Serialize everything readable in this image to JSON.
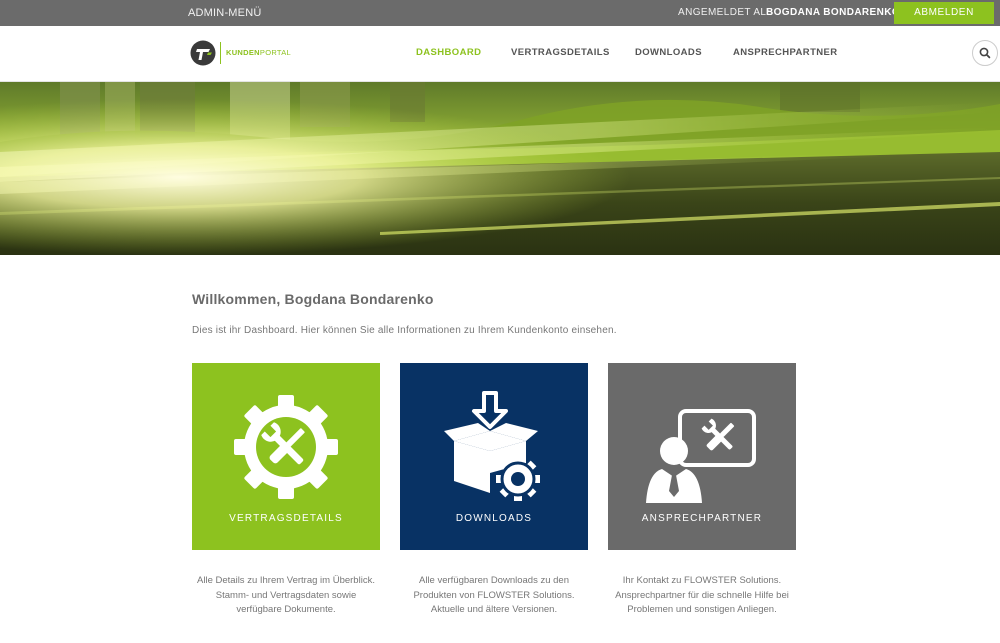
{
  "adminbar": {
    "menu_label": "ADMIN-MENÜ",
    "logged_in_label": "ANGEMELDET ALS",
    "user_name": "BOGDANA BONDARENKO",
    "logout_label": "ABMELDEN"
  },
  "header": {
    "logo_text_bold": "KUNDEN",
    "logo_text_light": "PORTAL",
    "nav": [
      {
        "label": "DASHBOARD",
        "active": true
      },
      {
        "label": "VERTRAGSDETAILS",
        "active": false
      },
      {
        "label": "DOWNLOADS",
        "active": false
      },
      {
        "label": "ANSPRECHPARTNER",
        "active": false
      }
    ],
    "search_icon": "search-icon"
  },
  "colors": {
    "accent": "#8dc21f",
    "navy": "#083264",
    "gray_tile": "#6a6a6a",
    "admin_bar": "#6b6b6b"
  },
  "main": {
    "title": "Willkommen, Bogdana Bondarenko",
    "intro": "Dies ist ihr Dashboard. Hier können Sie alle Informationen zu Ihrem Kundenkonto einsehen.",
    "tiles": [
      {
        "label": "VERTRAGSDETAILS",
        "icon": "gear-tools-icon",
        "desc": [
          "Alle Details zu Ihrem Vertrag im Überblick.",
          "Stamm- und Vertragsdaten sowie verfügbare Dokumente."
        ]
      },
      {
        "label": "DOWNLOADS",
        "icon": "box-download-icon",
        "desc": [
          "Alle verfügbaren Downloads zu den Produkten von FLOWSTER Solutions.",
          "Aktuelle und ältere Versionen."
        ]
      },
      {
        "label": "ANSPRECHPARTNER",
        "icon": "support-person-icon",
        "desc": [
          "Ihr Kontakt zu FLOWSTER Solutions.",
          "Ansprechpartner für die schnelle Hilfe bei Problemen und sonstigen Anliegen."
        ]
      }
    ]
  }
}
